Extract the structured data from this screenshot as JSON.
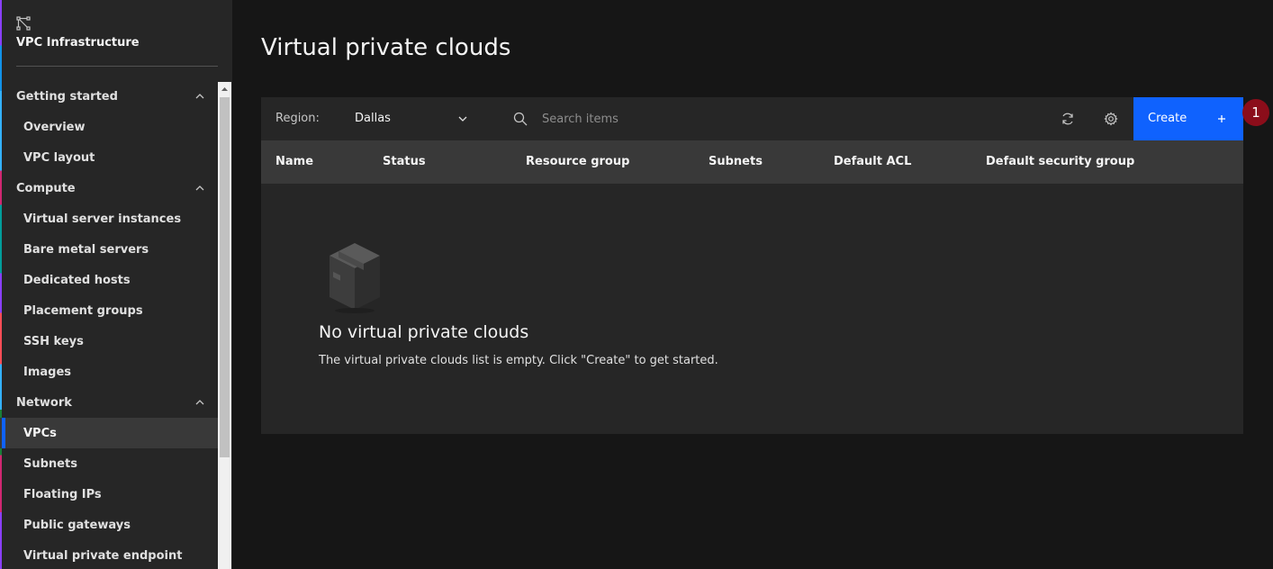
{
  "sidebar": {
    "brand_title": "VPC Infrastructure",
    "brand_icon": "vpc-icon",
    "sections": [
      {
        "label": "Getting started",
        "items": [
          "Overview",
          "VPC layout"
        ]
      },
      {
        "label": "Compute",
        "items": [
          "Virtual server instances",
          "Bare metal servers",
          "Dedicated hosts",
          "Placement groups",
          "SSH keys",
          "Images"
        ]
      },
      {
        "label": "Network",
        "items": [
          "VPCs",
          "Subnets",
          "Floating IPs",
          "Public gateways",
          "Virtual private endpoint"
        ]
      }
    ],
    "active_item": "VPCs"
  },
  "page": {
    "title": "Virtual private clouds"
  },
  "toolbar": {
    "region_label": "Region:",
    "region_value": "Dallas",
    "search_placeholder": "Search items",
    "create_label": "Create"
  },
  "table": {
    "columns": [
      "Name",
      "Status",
      "Resource group",
      "Subnets",
      "Default ACL",
      "Default security group"
    ]
  },
  "empty_state": {
    "title": "No virtual private clouds",
    "text": "The virtual private clouds list is empty. Click \"Create\" to get started."
  },
  "step_badge": "1",
  "colors": {
    "primary": "#0f62fe",
    "background": "#161616",
    "surface": "#262626",
    "header": "#393939",
    "badge": "#8b0d1a"
  }
}
